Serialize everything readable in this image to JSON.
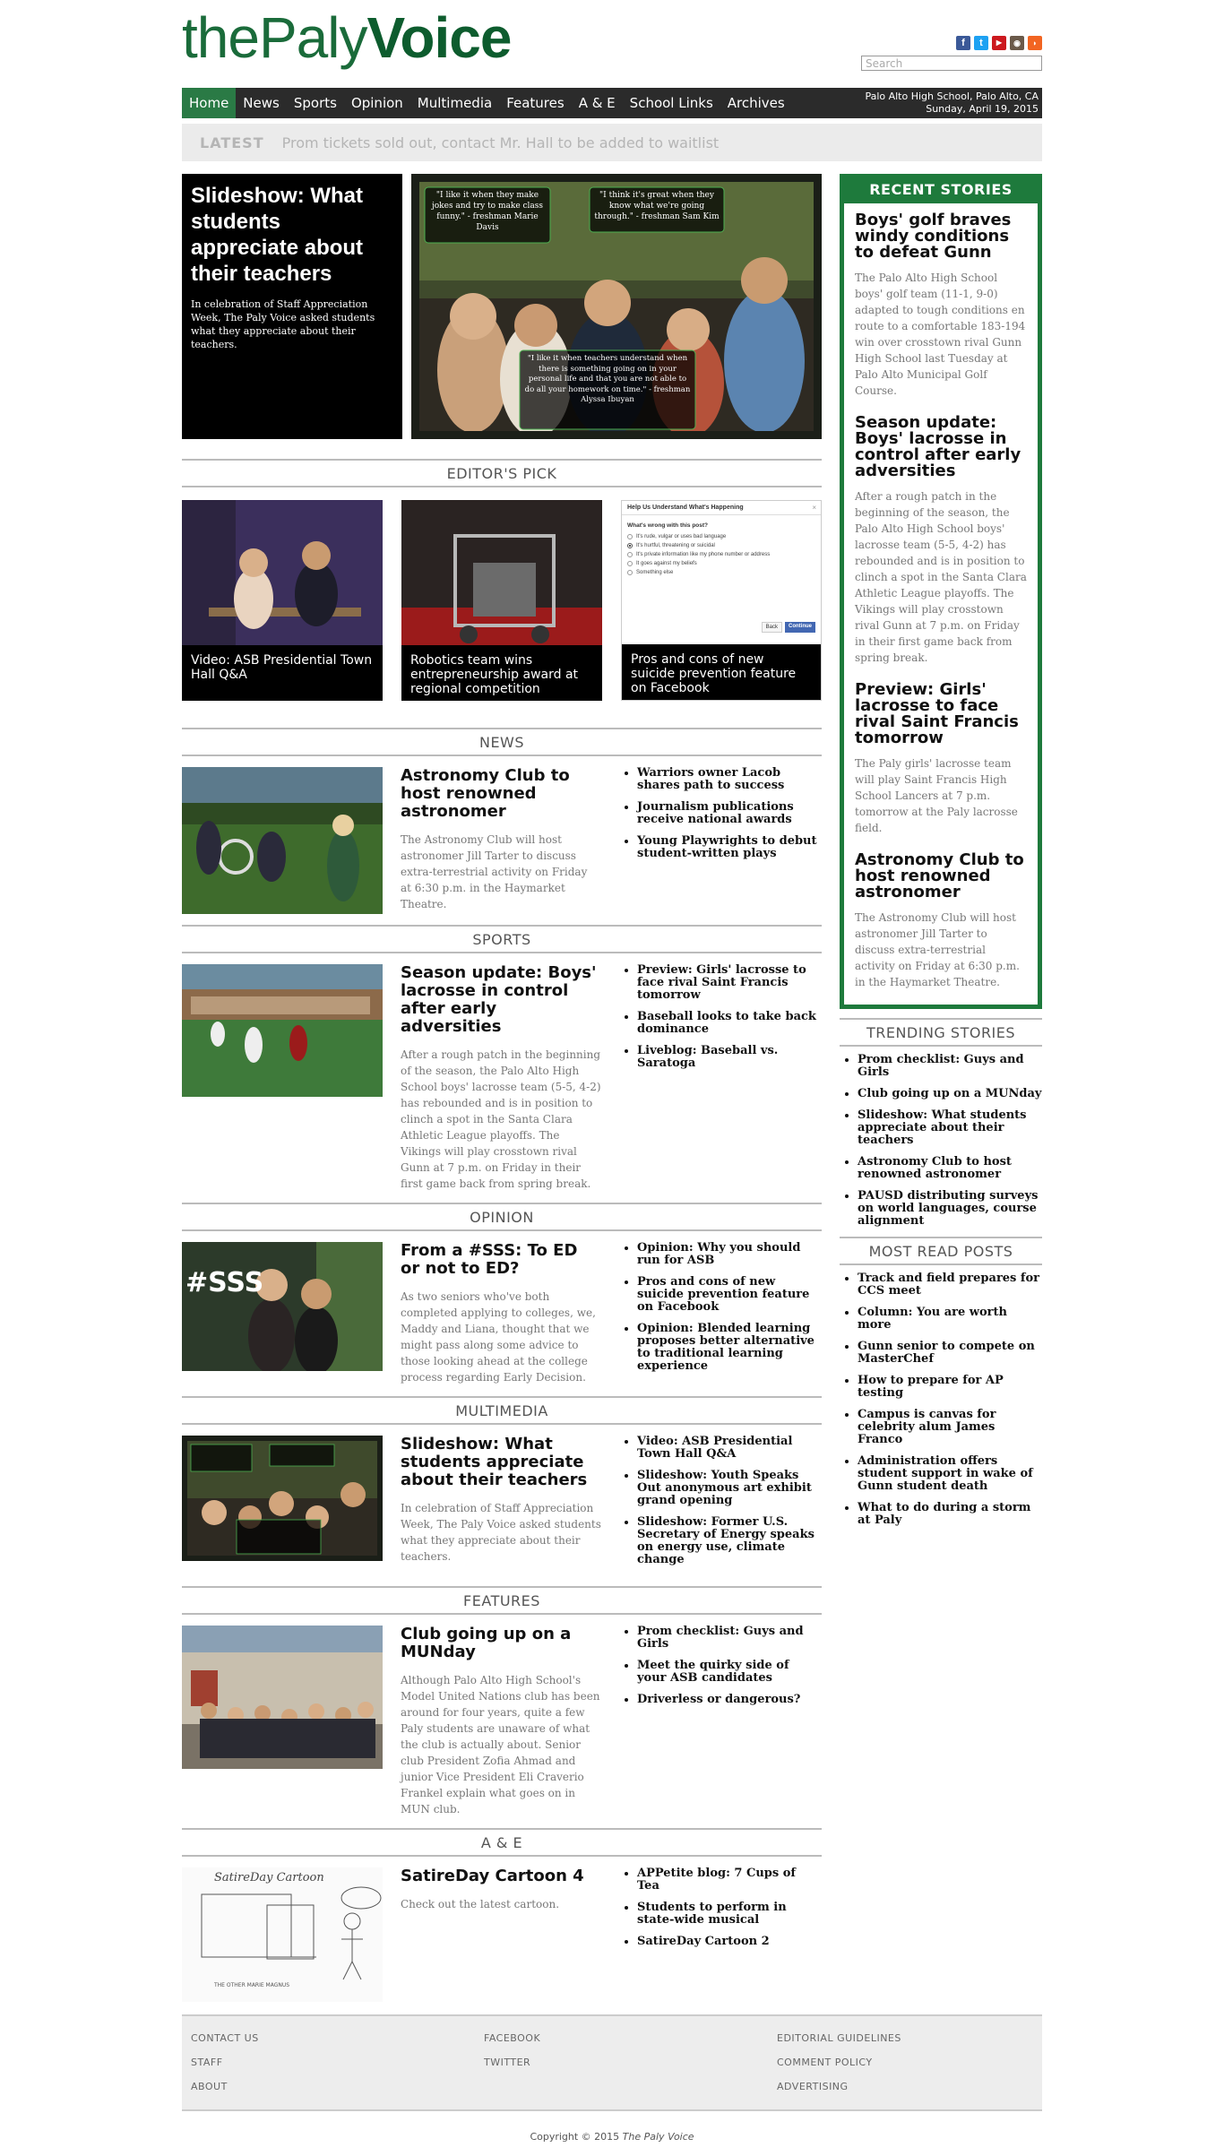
{
  "site": {
    "logo_light": "thePaly",
    "logo_bold": "Voice",
    "search_placeholder": "Search",
    "location": "Palo Alto High School, Palo Alto, CA",
    "date": "Sunday, April 19, 2015",
    "social_icons": [
      "facebook-icon",
      "twitter-icon",
      "youtube-icon",
      "instagram-icon",
      "rss-icon"
    ]
  },
  "nav": {
    "items": [
      "Home",
      "News",
      "Sports",
      "Opinion",
      "Multimedia",
      "Features",
      "A & E",
      "School Links",
      "Archives"
    ],
    "active": "Home"
  },
  "latest": {
    "label": "LATEST",
    "text": "Prom tickets sold out, contact Mr. Hall to be added to waitlist"
  },
  "feature": {
    "title": "Slideshow: What students appreciate about their teachers",
    "dek": "In celebration of Staff Appreciation Week, The Paly Voice asked students what they appreciate about their teachers.",
    "quotes": [
      "\"I like it when they make jokes and try to make class funny.\" - freshman Marie Davis",
      "\"I think it's great when they know what we're going through.\" - freshman Sam Kim",
      "\"I like it when teachers understand when there is something going on in your personal life and that you are not able to do all your homework on time.\" - freshman Alyssa Ibuyan"
    ]
  },
  "editors_pick": {
    "heading": "EDITOR'S PICK",
    "items": [
      "Video: ASB Presidential Town Hall Q&A",
      "Robotics team wins entrepreneurship award at regional competition",
      "Pros and cons of new suicide prevention feature on Facebook"
    ],
    "fb_dialog": {
      "title": "Help Us Understand What's Happening",
      "question": "What's wrong with this post?",
      "options": [
        "It's rude, vulgar or uses bad language",
        "It's hurtful, threatening or suicidal",
        "It's private information like my phone number or address",
        "It goes against my beliefs",
        "Something else"
      ],
      "back": "Back",
      "continue": "Continue"
    }
  },
  "sections": {
    "news": {
      "heading": "NEWS",
      "title": "Astronomy Club to host renowned astronomer",
      "dek": "The Astronomy Club will host astronomer Jill Tarter to discuss extra-terrestrial activity on Friday at 6:30 p.m. in the Haymarket Theatre.",
      "links": [
        "Warriors owner Lacob shares path to success",
        "Journalism publications receive national awards",
        "Young Playwrights to debut student-written plays"
      ]
    },
    "sports": {
      "heading": "SPORTS",
      "title": "Season update: Boys' lacrosse in control after early adversities",
      "dek": "After a rough patch in the beginning of the season, the Palo Alto High School boys' lacrosse team (5-5, 4-2) has rebounded and is in position to clinch a spot in the Santa Clara Athletic League playoffs. The Vikings will play crosstown rival Gunn at 7 p.m. on Friday in their first game back from spring break.",
      "links": [
        "Preview: Girls' lacrosse to face rival Saint Francis tomorrow",
        "Baseball looks to take back dominance",
        "Liveblog: Baseball vs. Saratoga"
      ]
    },
    "opinion": {
      "heading": "OPINION",
      "title": "From a #SSS: To ED or not to ED?",
      "dek": "As two seniors who've both completed applying to colleges, we, Maddy and Liana, thought that we might pass along some advice to those looking ahead at the college process regarding Early Decision.",
      "img_text": "#SSS",
      "links": [
        "Opinion: Why you should run for ASB",
        "Pros and cons of new suicide prevention feature on Facebook",
        "Opinion: Blended learning proposes better alternative to traditional learning experience"
      ]
    },
    "multimedia": {
      "heading": "MULTIMEDIA",
      "title": "Slideshow: What students appreciate about their teachers",
      "dek": "In celebration of Staff Appreciation Week, The Paly Voice asked students what they appreciate about their teachers.",
      "links": [
        "Video: ASB Presidential Town Hall Q&A",
        "Slideshow: Youth Speaks Out anonymous art exhibit grand opening",
        "Slideshow: Former U.S. Secretary of Energy speaks on energy use, climate change"
      ]
    },
    "features": {
      "heading": "FEATURES",
      "title": "Club going up on a MUNday",
      "dek": "Although Palo Alto High School's Model United Nations club has been around for four years, quite a few Paly students are unaware of what the club is actually about. Senior club President Zofia Ahmad and junior Vice President Eli Craverio Frankel explain what goes on in MUN club.",
      "links": [
        "Prom checklist: Guys and Girls",
        "Meet the quirky side of your ASB candidates",
        "Driverless or dangerous?"
      ]
    },
    "ae": {
      "heading": "A & E",
      "title": "SatireDay Cartoon 4",
      "dek": "Check out the latest cartoon.",
      "cartoon_title": "SatireDay Cartoon",
      "cartoon_credit": "THE OTHER MARIE MAGNUS",
      "links": [
        "APPetite blog: 7 Cups of Tea",
        "Students to perform in state-wide musical",
        "SatireDay Cartoon 2"
      ]
    }
  },
  "sidebar": {
    "recent_heading": "RECENT STORIES",
    "recent": [
      {
        "title": "Boys' golf braves windy conditions to defeat Gunn",
        "dek": "The Palo Alto High School boys' golf team (11-1, 9-0) adapted to tough conditions en route to a comfortable 183-194 win over crosstown rival Gunn High School last Tuesday at Palo Alto Municipal Golf Course."
      },
      {
        "title": "Season update: Boys' lacrosse in control after early adversities",
        "dek": "After a rough patch in the beginning of the season, the Palo Alto High School boys' lacrosse team (5-5, 4-2) has rebounded and is in position to clinch a spot in the Santa Clara Athletic League playoffs. The Vikings will play crosstown rival Gunn at 7 p.m. on Friday in their first game back from spring break."
      },
      {
        "title": "Preview: Girls' lacrosse to face rival Saint Francis tomorrow",
        "dek": "The Paly girls' lacrosse team will play Saint Francis High School Lancers at 7 p.m. tomorrow at the Paly lacrosse field."
      },
      {
        "title": "Astronomy Club to host renowned astronomer",
        "dek": "The Astronomy Club will host astronomer Jill Tarter to discuss extra-terrestrial activity on Friday at 6:30 p.m. in the Haymarket Theatre."
      }
    ],
    "trending_heading": "TRENDING STORIES",
    "trending": [
      "Prom checklist: Guys and Girls",
      "Club going up on a MUNday",
      "Slideshow: What students appreciate about their teachers",
      "Astronomy Club to host renowned astronomer",
      "PAUSD distributing surveys on world languages, course alignment"
    ],
    "most_read_heading": "MOST READ POSTS",
    "most_read": [
      "Track and field prepares for CCS meet",
      "Column: You are worth more",
      "Gunn senior to compete on MasterChef",
      "How to prepare for AP testing",
      "Campus is canvas for celebrity alum James Franco",
      "Administration offers student support in wake of Gunn student death",
      "What to do during a storm at Paly"
    ]
  },
  "footer": {
    "col1": [
      "CONTACT US",
      "STAFF",
      "ABOUT"
    ],
    "col2": [
      "FACEBOOK",
      "TWITTER"
    ],
    "col3": [
      "EDITORIAL GUIDELINES",
      "COMMENT POLICY",
      "ADVERTISING"
    ],
    "copyright_prefix": "Copyright © 2015 ",
    "copyright_name": "The Paly Voice"
  }
}
